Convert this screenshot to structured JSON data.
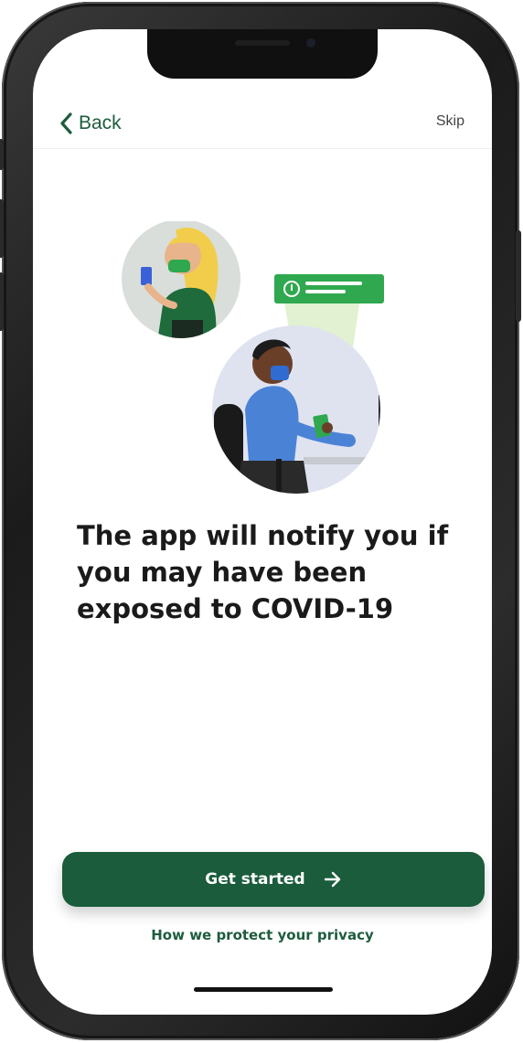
{
  "nav": {
    "back_label": "Back",
    "skip_label": "Skip"
  },
  "illustration": {
    "icon": "exposure-notification-illustration"
  },
  "main": {
    "headline": "The app will notify you if you may have been exposed to COVID-19"
  },
  "actions": {
    "primary_label": "Get started",
    "primary_icon": "arrow-right-icon",
    "privacy_link": "How we protect your privacy"
  },
  "colors": {
    "brand": "#1a5c3b",
    "accent": "#2fa84f"
  }
}
